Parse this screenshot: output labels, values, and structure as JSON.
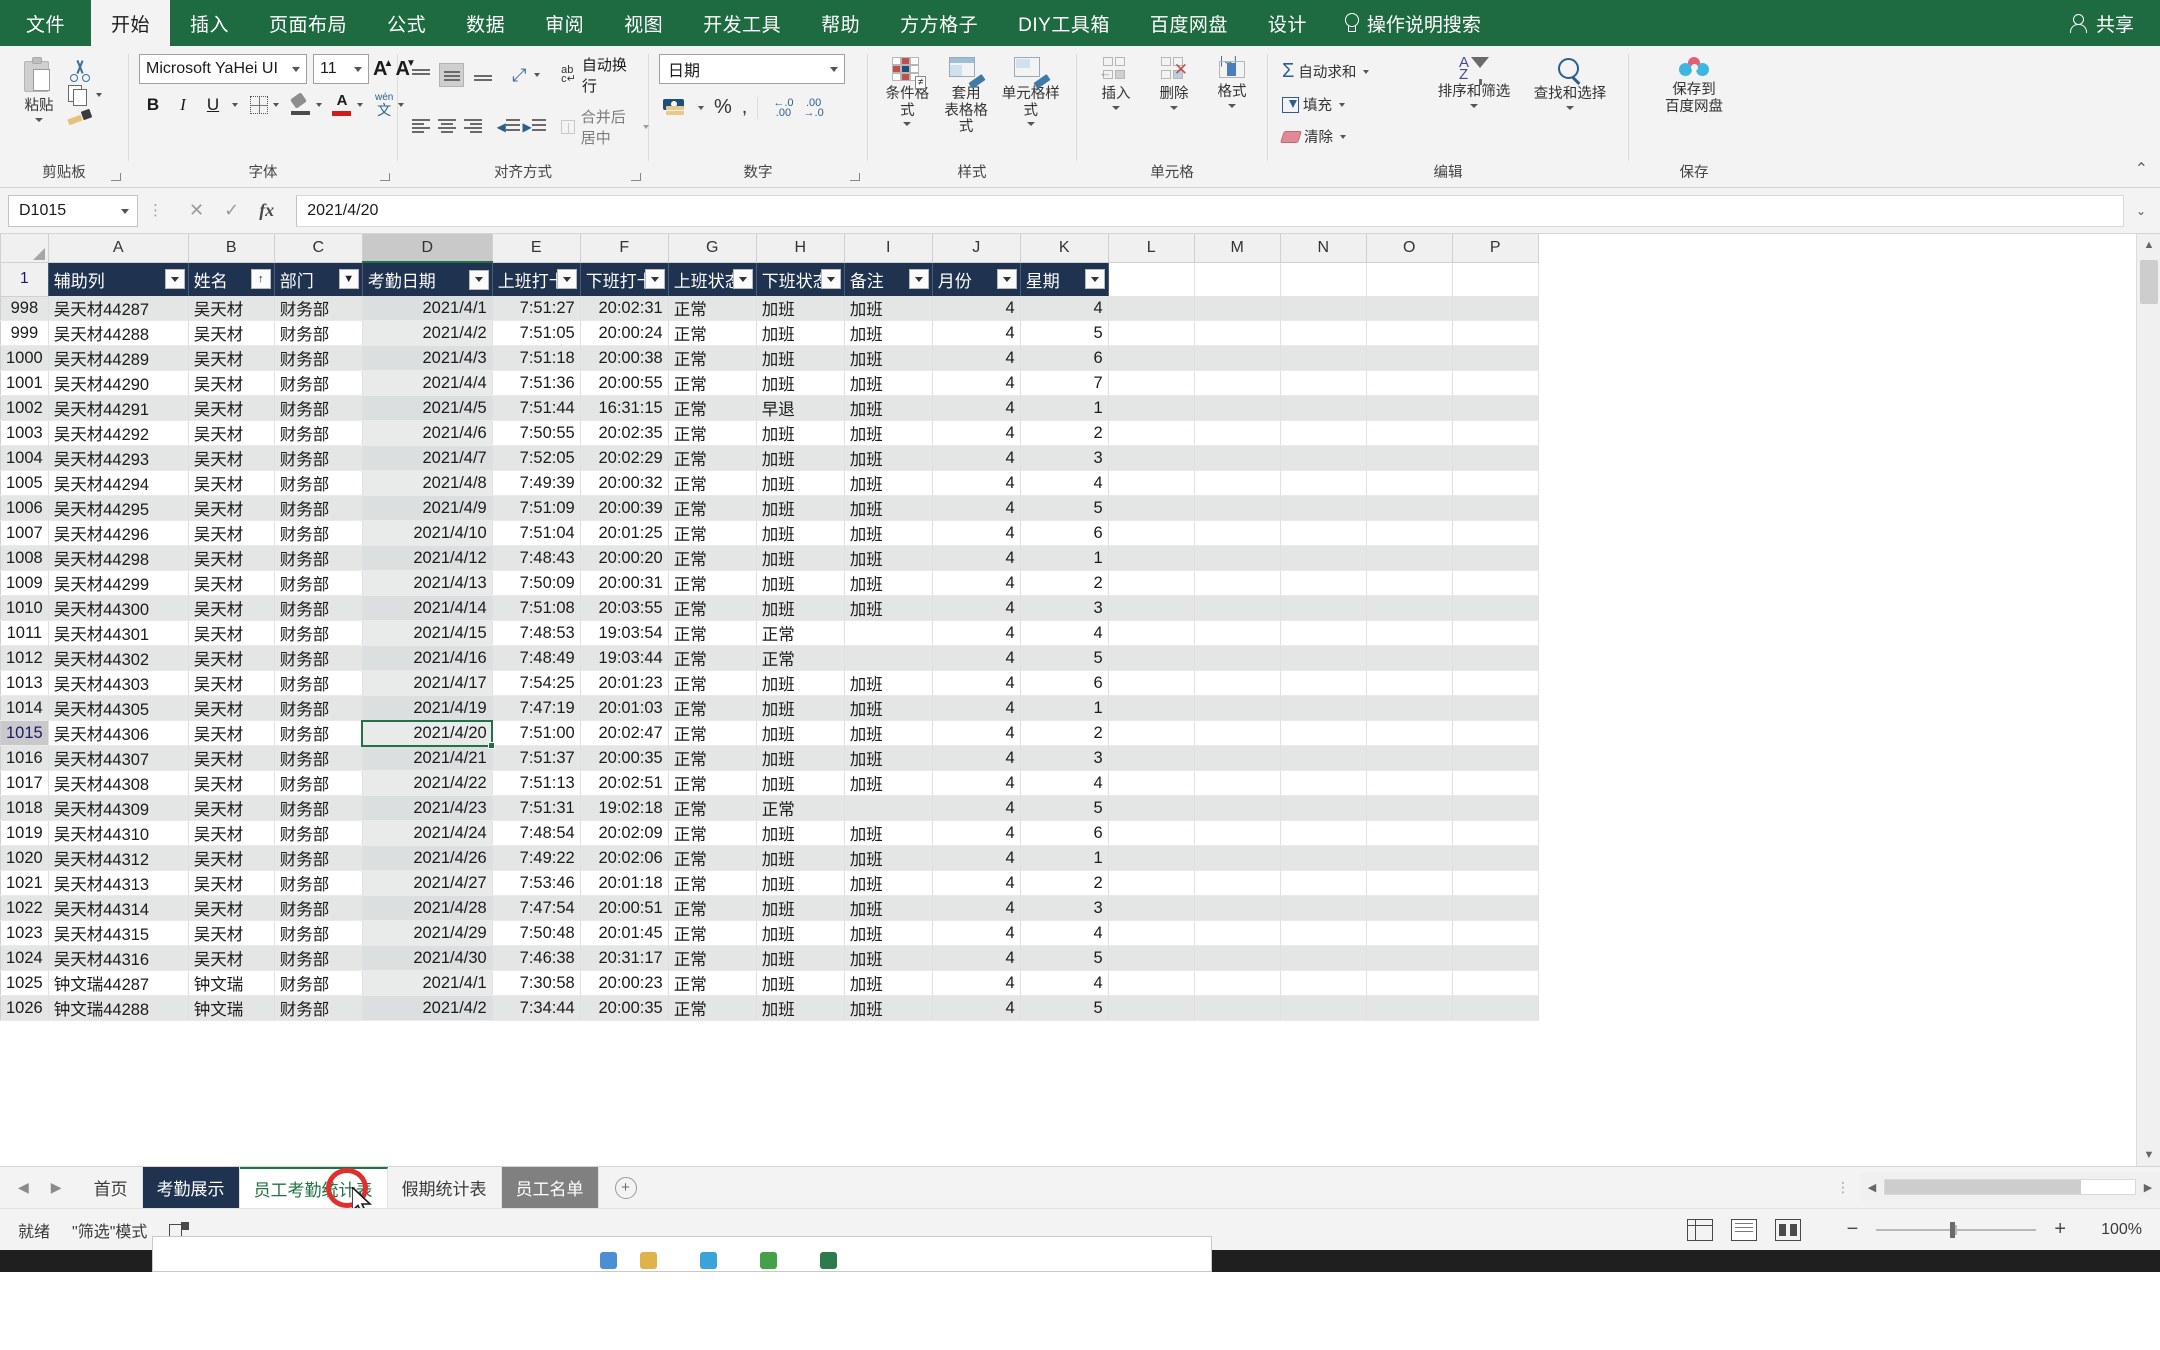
{
  "ribbon": {
    "tabs": [
      "文件",
      "开始",
      "插入",
      "页面布局",
      "公式",
      "数据",
      "审阅",
      "视图",
      "开发工具",
      "帮助",
      "方方格子",
      "DIY工具箱",
      "百度网盘",
      "设计"
    ],
    "active_tab": "开始",
    "search_label": "操作说明搜索",
    "share_label": "共享",
    "groups": {
      "clipboard": {
        "title": "剪贴板",
        "paste": "粘贴"
      },
      "font": {
        "title": "字体",
        "font_name": "Microsoft YaHei UI",
        "font_size": "11"
      },
      "align": {
        "title": "对齐方式",
        "wrap": "自动换行",
        "merge": "合并后居中"
      },
      "number": {
        "title": "数字",
        "format": "日期"
      },
      "styles": {
        "title": "样式",
        "cond": "条件格式",
        "table1": "套用",
        "table2": "表格格式",
        "cell": "单元格样式"
      },
      "cells": {
        "title": "单元格",
        "insert": "插入",
        "delete": "删除",
        "format": "格式"
      },
      "editing": {
        "title": "编辑",
        "autosum": "自动求和",
        "fill": "填充",
        "clear": "清除",
        "sortfilter": "排序和筛选",
        "findselect": "查找和选择"
      },
      "save": {
        "title": "保存",
        "line1": "保存到",
        "line2": "百度网盘"
      }
    }
  },
  "formula_bar": {
    "name_box": "D1015",
    "cancel": "✕",
    "confirm": "✓",
    "fx": "fx",
    "value": "2021/4/20"
  },
  "grid": {
    "column_letters": [
      "A",
      "B",
      "C",
      "D",
      "E",
      "F",
      "G",
      "H",
      "I",
      "J",
      "K",
      "L",
      "M",
      "N",
      "O",
      "P"
    ],
    "selected_column": "D",
    "header_row_number": "1",
    "headers": [
      "辅助列",
      "姓名",
      "部门",
      "考勤日期",
      "上班打卡",
      "下班打卡",
      "上班状态",
      "下班状态",
      "备注",
      "月份",
      "星期"
    ],
    "rows": [
      {
        "n": "998",
        "c": [
          "吴天材44287",
          "吴天材",
          "财务部",
          "2021/4/1",
          "7:51:27",
          "20:02:31",
          "正常",
          "加班",
          "加班",
          "4",
          "4"
        ]
      },
      {
        "n": "999",
        "c": [
          "吴天材44288",
          "吴天材",
          "财务部",
          "2021/4/2",
          "7:51:05",
          "20:00:24",
          "正常",
          "加班",
          "加班",
          "4",
          "5"
        ]
      },
      {
        "n": "1000",
        "c": [
          "吴天材44289",
          "吴天材",
          "财务部",
          "2021/4/3",
          "7:51:18",
          "20:00:38",
          "正常",
          "加班",
          "加班",
          "4",
          "6"
        ]
      },
      {
        "n": "1001",
        "c": [
          "吴天材44290",
          "吴天材",
          "财务部",
          "2021/4/4",
          "7:51:36",
          "20:00:55",
          "正常",
          "加班",
          "加班",
          "4",
          "7"
        ]
      },
      {
        "n": "1002",
        "c": [
          "吴天材44291",
          "吴天材",
          "财务部",
          "2021/4/5",
          "7:51:44",
          "16:31:15",
          "正常",
          "早退",
          "加班",
          "4",
          "1"
        ]
      },
      {
        "n": "1003",
        "c": [
          "吴天材44292",
          "吴天材",
          "财务部",
          "2021/4/6",
          "7:50:55",
          "20:02:35",
          "正常",
          "加班",
          "加班",
          "4",
          "2"
        ]
      },
      {
        "n": "1004",
        "c": [
          "吴天材44293",
          "吴天材",
          "财务部",
          "2021/4/7",
          "7:52:05",
          "20:02:29",
          "正常",
          "加班",
          "加班",
          "4",
          "3"
        ]
      },
      {
        "n": "1005",
        "c": [
          "吴天材44294",
          "吴天材",
          "财务部",
          "2021/4/8",
          "7:49:39",
          "20:00:32",
          "正常",
          "加班",
          "加班",
          "4",
          "4"
        ]
      },
      {
        "n": "1006",
        "c": [
          "吴天材44295",
          "吴天材",
          "财务部",
          "2021/4/9",
          "7:51:09",
          "20:00:39",
          "正常",
          "加班",
          "加班",
          "4",
          "5"
        ]
      },
      {
        "n": "1007",
        "c": [
          "吴天材44296",
          "吴天材",
          "财务部",
          "2021/4/10",
          "7:51:04",
          "20:01:25",
          "正常",
          "加班",
          "加班",
          "4",
          "6"
        ]
      },
      {
        "n": "1008",
        "c": [
          "吴天材44298",
          "吴天材",
          "财务部",
          "2021/4/12",
          "7:48:43",
          "20:00:20",
          "正常",
          "加班",
          "加班",
          "4",
          "1"
        ]
      },
      {
        "n": "1009",
        "c": [
          "吴天材44299",
          "吴天材",
          "财务部",
          "2021/4/13",
          "7:50:09",
          "20:00:31",
          "正常",
          "加班",
          "加班",
          "4",
          "2"
        ]
      },
      {
        "n": "1010",
        "c": [
          "吴天材44300",
          "吴天材",
          "财务部",
          "2021/4/14",
          "7:51:08",
          "20:03:55",
          "正常",
          "加班",
          "加班",
          "4",
          "3"
        ]
      },
      {
        "n": "1011",
        "c": [
          "吴天材44301",
          "吴天材",
          "财务部",
          "2021/4/15",
          "7:48:53",
          "19:03:54",
          "正常",
          "正常",
          "",
          "4",
          "4"
        ]
      },
      {
        "n": "1012",
        "c": [
          "吴天材44302",
          "吴天材",
          "财务部",
          "2021/4/16",
          "7:48:49",
          "19:03:44",
          "正常",
          "正常",
          "",
          "4",
          "5"
        ]
      },
      {
        "n": "1013",
        "c": [
          "吴天材44303",
          "吴天材",
          "财务部",
          "2021/4/17",
          "7:54:25",
          "20:01:23",
          "正常",
          "加班",
          "加班",
          "4",
          "6"
        ]
      },
      {
        "n": "1014",
        "c": [
          "吴天材44305",
          "吴天材",
          "财务部",
          "2021/4/19",
          "7:47:19",
          "20:01:03",
          "正常",
          "加班",
          "加班",
          "4",
          "1"
        ]
      },
      {
        "n": "1015",
        "c": [
          "吴天材44306",
          "吴天材",
          "财务部",
          "2021/4/20",
          "7:51:00",
          "20:02:47",
          "正常",
          "加班",
          "加班",
          "4",
          "2"
        ]
      },
      {
        "n": "1016",
        "c": [
          "吴天材44307",
          "吴天材",
          "财务部",
          "2021/4/21",
          "7:51:37",
          "20:00:35",
          "正常",
          "加班",
          "加班",
          "4",
          "3"
        ]
      },
      {
        "n": "1017",
        "c": [
          "吴天材44308",
          "吴天材",
          "财务部",
          "2021/4/22",
          "7:51:13",
          "20:02:51",
          "正常",
          "加班",
          "加班",
          "4",
          "4"
        ]
      },
      {
        "n": "1018",
        "c": [
          "吴天材44309",
          "吴天材",
          "财务部",
          "2021/4/23",
          "7:51:31",
          "19:02:18",
          "正常",
          "正常",
          "",
          "4",
          "5"
        ]
      },
      {
        "n": "1019",
        "c": [
          "吴天材44310",
          "吴天材",
          "财务部",
          "2021/4/24",
          "7:48:54",
          "20:02:09",
          "正常",
          "加班",
          "加班",
          "4",
          "6"
        ]
      },
      {
        "n": "1020",
        "c": [
          "吴天材44312",
          "吴天材",
          "财务部",
          "2021/4/26",
          "7:49:22",
          "20:02:06",
          "正常",
          "加班",
          "加班",
          "4",
          "1"
        ]
      },
      {
        "n": "1021",
        "c": [
          "吴天材44313",
          "吴天材",
          "财务部",
          "2021/4/27",
          "7:53:46",
          "20:01:18",
          "正常",
          "加班",
          "加班",
          "4",
          "2"
        ]
      },
      {
        "n": "1022",
        "c": [
          "吴天材44314",
          "吴天材",
          "财务部",
          "2021/4/28",
          "7:47:54",
          "20:00:51",
          "正常",
          "加班",
          "加班",
          "4",
          "3"
        ]
      },
      {
        "n": "1023",
        "c": [
          "吴天材44315",
          "吴天材",
          "财务部",
          "2021/4/29",
          "7:50:48",
          "20:01:45",
          "正常",
          "加班",
          "加班",
          "4",
          "4"
        ]
      },
      {
        "n": "1024",
        "c": [
          "吴天材44316",
          "吴天材",
          "财务部",
          "2021/4/30",
          "7:46:38",
          "20:31:17",
          "正常",
          "加班",
          "加班",
          "4",
          "5"
        ]
      },
      {
        "n": "1025",
        "c": [
          "钟文瑞44287",
          "钟文瑞",
          "财务部",
          "2021/4/1",
          "7:30:58",
          "20:00:23",
          "正常",
          "加班",
          "加班",
          "4",
          "4"
        ]
      },
      {
        "n": "1026",
        "c": [
          "钟文瑞44288",
          "钟文瑞",
          "财务部",
          "2021/4/2",
          "7:34:44",
          "20:00:35",
          "正常",
          "加班",
          "加班",
          "4",
          "5"
        ]
      }
    ]
  },
  "sheet_tabs": {
    "items": [
      "首页",
      "考勤展示",
      "员工考勤统计表",
      "假期统计表",
      "员工名单"
    ],
    "active": "员工考勤统计表",
    "add_label": "+"
  },
  "status_bar": {
    "ready": "就绪",
    "mode": "\"筛选\"模式",
    "zoom": "100%",
    "zoom_out": "−",
    "zoom_in": "+"
  }
}
